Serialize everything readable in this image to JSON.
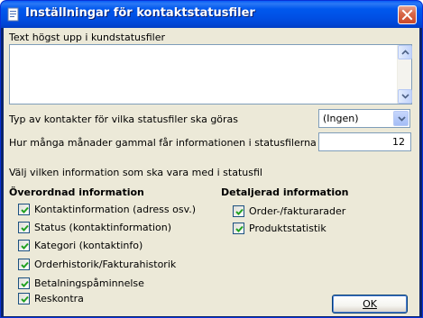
{
  "window": {
    "title": "Inställningar för kontaktstatusfiler",
    "close_icon": "close-icon",
    "app_icon": "document-icon"
  },
  "top_text": {
    "label": "Text högst upp i kundstatusfiler",
    "value": ""
  },
  "contact_type": {
    "label": "Typ av kontakter för vilka statusfiler ska göras",
    "selected": "(Ingen)"
  },
  "months": {
    "label": "Hur många månader gammal får informationen i statusfilerna vara?",
    "value": "12"
  },
  "choose_label": "Välj vilken information som ska vara med i statusfil",
  "overview": {
    "heading": "Överordnad information",
    "items": [
      {
        "label": "Kontaktinformation (adress osv.)",
        "checked": true
      },
      {
        "label": "Status (kontaktinformation)",
        "checked": true
      },
      {
        "label": "Kategori (kontaktinfo)",
        "checked": true
      },
      {
        "label": "Orderhistorik/Fakturahistorik",
        "checked": true
      },
      {
        "label": "Betalningspåminnelse",
        "checked": true
      },
      {
        "label": "Reskontra",
        "checked": true
      }
    ]
  },
  "detail": {
    "heading": "Detaljerad information",
    "items": [
      {
        "label": "Order-/fakturarader",
        "checked": true
      },
      {
        "label": "Produktstatistik",
        "checked": true
      }
    ]
  },
  "ok_button": {
    "label": "OK"
  }
}
